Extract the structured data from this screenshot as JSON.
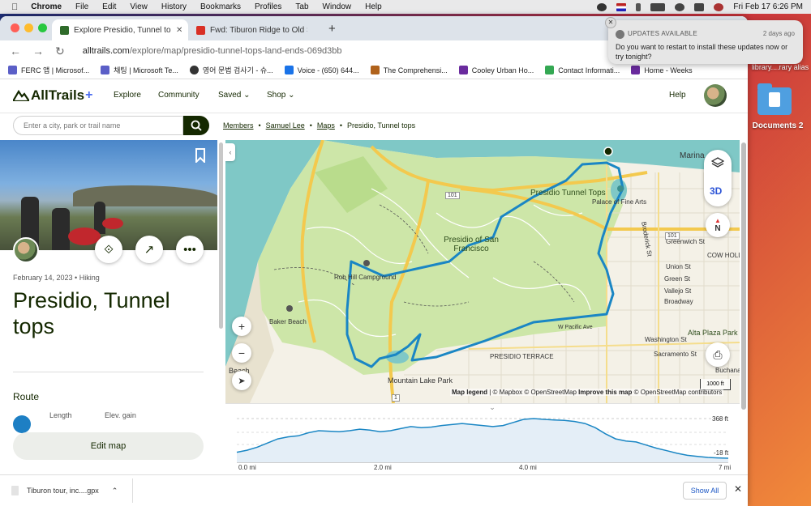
{
  "menubar": {
    "app": "Chrome",
    "items": [
      "File",
      "Edit",
      "View",
      "History",
      "Bookmarks",
      "Profiles",
      "Tab",
      "Window",
      "Help"
    ],
    "datetime": "Fri Feb 17  6:26 PM"
  },
  "desktop": {
    "folder_label": "Documents 2",
    "partial_label": "library....rary alias"
  },
  "notification": {
    "header": "UPDATES AVAILABLE",
    "time": "2 days ago",
    "body": "Do you want to restart to install these updates now or try tonight?"
  },
  "tabs": [
    {
      "title": "Explore Presidio, Tunnel tops |",
      "active": true
    },
    {
      "title": "Fwd: Tiburon Ridge to Old St H",
      "active": false
    }
  ],
  "url": {
    "host": "alltrails.com",
    "path": "/explore/map/presidio-tunnel-tops-land-ends-069d3bb"
  },
  "bookmarks": [
    "FERC 앱 | Microsof...",
    "채팅 | Microsoft Te...",
    "영어 문법 검사기 - 슈...",
    "Voice - (650) 644...",
    "The Comprehensi...",
    "Cooley Urban Ho...",
    "Contact Informati...",
    "Home - Weeks"
  ],
  "site": {
    "brand": "AllTrails",
    "brand_plus": "+",
    "nav": [
      "Explore",
      "Community",
      "Saved",
      "Shop"
    ],
    "help": "Help",
    "search_placeholder": "Enter a city, park or trail name"
  },
  "breadcrumbs": [
    "Members",
    "Samuel Lee",
    "Maps",
    "Presidio, Tunnel tops"
  ],
  "map_page": {
    "date": "February 14, 2023",
    "activity": "Hiking",
    "title": "Presidio, Tunnel tops",
    "route_heading": "Route",
    "length_label": "Length",
    "elev_label": "Elev. gain",
    "edit_button": "Edit map"
  },
  "map": {
    "labels": {
      "presidio_tunnel_tops": "Presidio Tunnel Tops",
      "presidio_sf": "Presidio of San Francisco",
      "palace": "Palace of Fine Arts",
      "rob_hill": "Rob Hill Campground",
      "baker_beach": "Baker Beach",
      "presidio_terrace": "PRESIDIO TERRACE",
      "mountain_lake": "Mountain Lake Park",
      "marina": "Marina",
      "cow_hollow": "COW HOLLOW",
      "alta_plaza": "Alta Plaza Park",
      "beach": "Beach",
      "broadway": "Broadway",
      "vallejo": "Vallejo St",
      "union": "Union St",
      "greenwich": "Greenwich St",
      "green": "Green St",
      "pacific": "W Pacific Ave",
      "washington": "Washington St",
      "sacramento": "Sacramento St",
      "buchanan": "Buchanan",
      "broderick": "Broderick St",
      "route_101a": "101",
      "route_101b": "101",
      "route_1": "1"
    },
    "control_3d": "3D",
    "compass": "N",
    "attribution": {
      "legend": "Map legend",
      "sep": " | © Mapbox © OpenStreetMap ",
      "improve": "Improve this map",
      "osm": " © OpenStreetMap contributors"
    },
    "scale": "1000 ft"
  },
  "elevation": {
    "y_max": "368 ft",
    "y_min": "-18 ft",
    "x_ticks": [
      "0.0 mi",
      "2.0 mi",
      "4.0 mi",
      "7 mi"
    ],
    "profile_ft": [
      40,
      60,
      90,
      130,
      170,
      190,
      200,
      230,
      250,
      245,
      240,
      250,
      265,
      255,
      240,
      250,
      270,
      290,
      280,
      285,
      300,
      310,
      320,
      310,
      300,
      290,
      300,
      330,
      360,
      368,
      360,
      355,
      350,
      340,
      320,
      280,
      220,
      170,
      150,
      140,
      110,
      80,
      55,
      30,
      10,
      0,
      -10,
      -15,
      -18
    ]
  },
  "download": {
    "file": "Tiburon tour, inc....gpx",
    "show_all": "Show All"
  },
  "colors": {
    "route": "#1a86c4",
    "brand_dark": "#142800",
    "park_green": "#cde6a8",
    "water": "#7fc8c6",
    "road_yellow": "#f3c94e"
  }
}
